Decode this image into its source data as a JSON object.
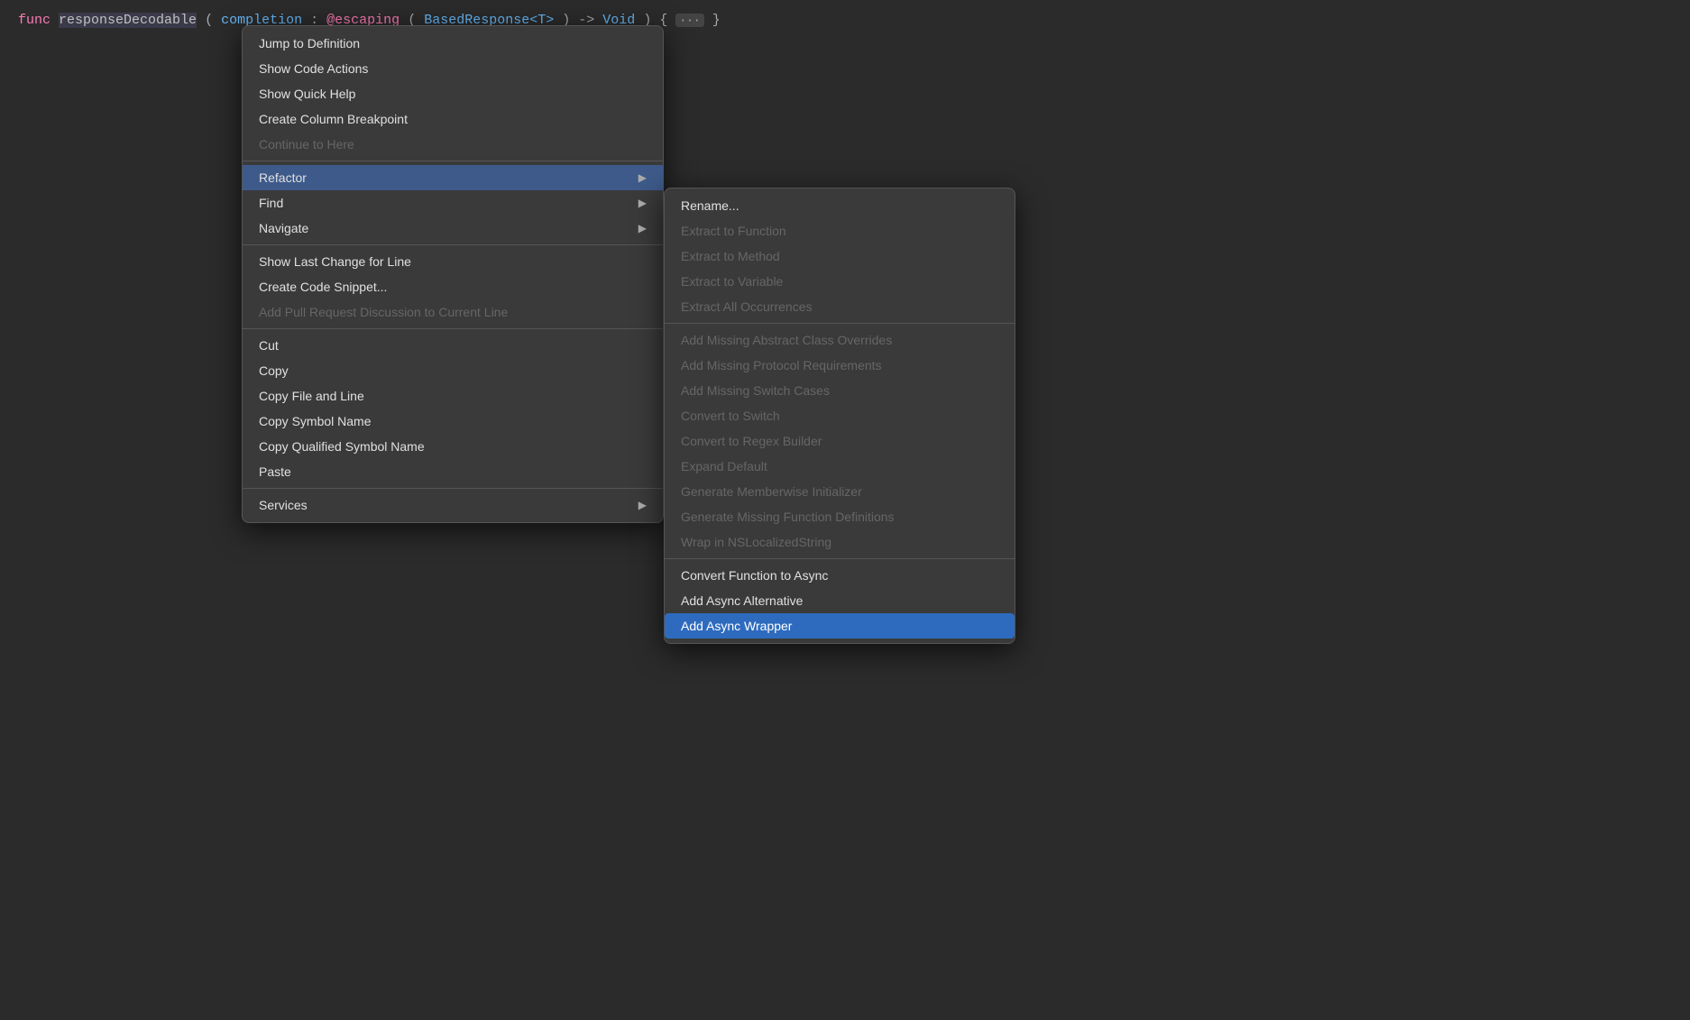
{
  "editor": {
    "code_line": {
      "keyword": "func",
      "fn_name": "responseDecodable",
      "params": "completion: @escaping (BasedResponse<T>) -> Void) { ... }"
    }
  },
  "primary_menu": {
    "items": [
      {
        "id": "jump-to-definition",
        "label": "Jump to Definition",
        "disabled": false,
        "has_submenu": false,
        "separator_after": false
      },
      {
        "id": "show-code-actions",
        "label": "Show Code Actions",
        "disabled": false,
        "has_submenu": false,
        "separator_after": false
      },
      {
        "id": "show-quick-help",
        "label": "Show Quick Help",
        "disabled": false,
        "has_submenu": false,
        "separator_after": false
      },
      {
        "id": "create-column-breakpoint",
        "label": "Create Column Breakpoint",
        "disabled": false,
        "has_submenu": false,
        "separator_after": false
      },
      {
        "id": "continue-to-here",
        "label": "Continue to Here",
        "disabled": true,
        "has_submenu": false,
        "separator_after": true
      },
      {
        "id": "refactor",
        "label": "Refactor",
        "disabled": false,
        "has_submenu": true,
        "separator_after": false,
        "active": true
      },
      {
        "id": "find",
        "label": "Find",
        "disabled": false,
        "has_submenu": true,
        "separator_after": false
      },
      {
        "id": "navigate",
        "label": "Navigate",
        "disabled": false,
        "has_submenu": true,
        "separator_after": true
      },
      {
        "id": "show-last-change",
        "label": "Show Last Change for Line",
        "disabled": false,
        "has_submenu": false,
        "separator_after": false
      },
      {
        "id": "create-code-snippet",
        "label": "Create Code Snippet...",
        "disabled": false,
        "has_submenu": false,
        "separator_after": false
      },
      {
        "id": "add-pull-request",
        "label": "Add Pull Request Discussion to Current Line",
        "disabled": true,
        "has_submenu": false,
        "separator_after": true
      },
      {
        "id": "cut",
        "label": "Cut",
        "disabled": false,
        "has_submenu": false,
        "separator_after": false
      },
      {
        "id": "copy",
        "label": "Copy",
        "disabled": false,
        "has_submenu": false,
        "separator_after": false
      },
      {
        "id": "copy-file-line",
        "label": "Copy File and Line",
        "disabled": false,
        "has_submenu": false,
        "separator_after": false
      },
      {
        "id": "copy-symbol-name",
        "label": "Copy Symbol Name",
        "disabled": false,
        "has_submenu": false,
        "separator_after": false
      },
      {
        "id": "copy-qualified-symbol",
        "label": "Copy Qualified Symbol Name",
        "disabled": false,
        "has_submenu": false,
        "separator_after": false
      },
      {
        "id": "paste",
        "label": "Paste",
        "disabled": false,
        "has_submenu": false,
        "separator_after": true
      },
      {
        "id": "services",
        "label": "Services",
        "disabled": false,
        "has_submenu": true,
        "separator_after": false
      }
    ]
  },
  "secondary_menu": {
    "items": [
      {
        "id": "rename",
        "label": "Rename...",
        "disabled": false,
        "highlighted": false,
        "separator_after": false
      },
      {
        "id": "extract-to-function",
        "label": "Extract to Function",
        "disabled": true,
        "highlighted": false,
        "separator_after": false
      },
      {
        "id": "extract-to-method",
        "label": "Extract to Method",
        "disabled": true,
        "highlighted": false,
        "separator_after": false
      },
      {
        "id": "extract-to-variable",
        "label": "Extract to Variable",
        "disabled": true,
        "highlighted": false,
        "separator_after": false
      },
      {
        "id": "extract-all-occurrences",
        "label": "Extract All Occurrences",
        "disabled": true,
        "highlighted": false,
        "separator_after": true
      },
      {
        "id": "add-missing-abstract",
        "label": "Add Missing Abstract Class Overrides",
        "disabled": true,
        "highlighted": false,
        "separator_after": false
      },
      {
        "id": "add-missing-protocol",
        "label": "Add Missing Protocol Requirements",
        "disabled": true,
        "highlighted": false,
        "separator_after": false
      },
      {
        "id": "add-missing-switch",
        "label": "Add Missing Switch Cases",
        "disabled": true,
        "highlighted": false,
        "separator_after": false
      },
      {
        "id": "convert-to-switch",
        "label": "Convert to Switch",
        "disabled": true,
        "highlighted": false,
        "separator_after": false
      },
      {
        "id": "convert-to-regex",
        "label": "Convert to Regex Builder",
        "disabled": true,
        "highlighted": false,
        "separator_after": false
      },
      {
        "id": "expand-default",
        "label": "Expand Default",
        "disabled": true,
        "highlighted": false,
        "separator_after": false
      },
      {
        "id": "generate-memberwise",
        "label": "Generate Memberwise Initializer",
        "disabled": true,
        "highlighted": false,
        "separator_after": false
      },
      {
        "id": "generate-missing-fn",
        "label": "Generate Missing Function Definitions",
        "disabled": true,
        "highlighted": false,
        "separator_after": false
      },
      {
        "id": "wrap-in-ns",
        "label": "Wrap in NSLocalizedString",
        "disabled": true,
        "highlighted": false,
        "separator_after": true
      },
      {
        "id": "convert-fn-async",
        "label": "Convert Function to Async",
        "disabled": false,
        "highlighted": false,
        "separator_after": false
      },
      {
        "id": "add-async-alternative",
        "label": "Add Async Alternative",
        "disabled": false,
        "highlighted": false,
        "separator_after": false
      },
      {
        "id": "add-async-wrapper",
        "label": "Add Async Wrapper",
        "disabled": false,
        "highlighted": true,
        "separator_after": false
      }
    ]
  }
}
